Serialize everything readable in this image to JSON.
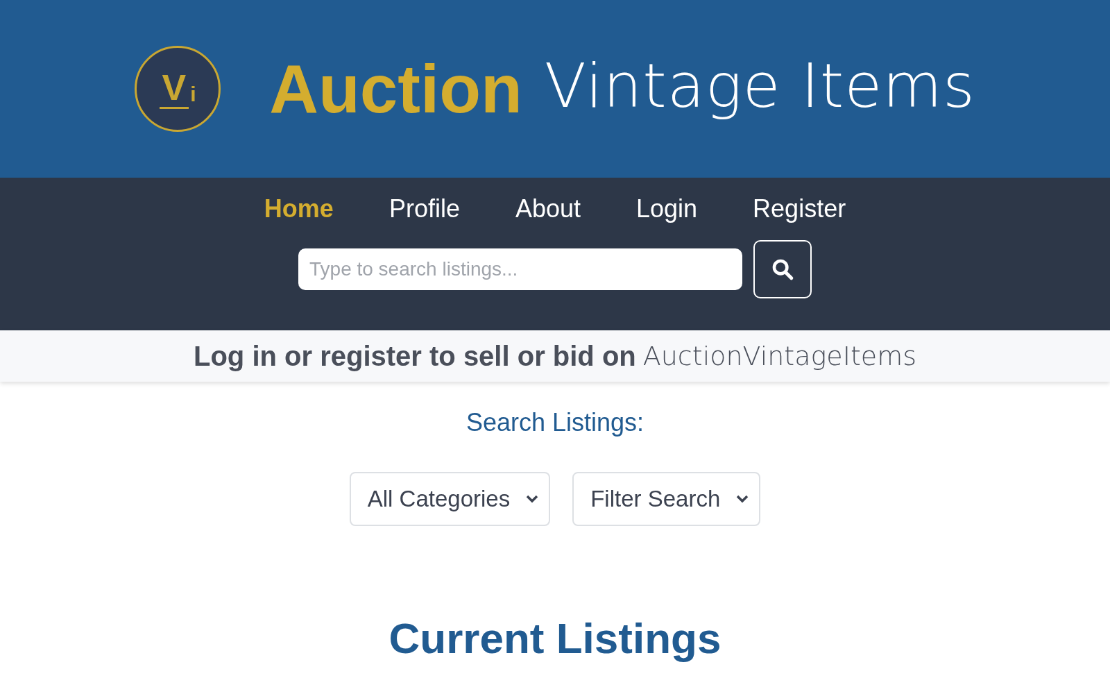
{
  "header": {
    "logo": {
      "letter": "V",
      "sub": "i"
    },
    "title_strong": "Auction",
    "title_light": "Vintage Items"
  },
  "nav": {
    "items": [
      {
        "label": "Home",
        "selected": true
      },
      {
        "label": "Profile",
        "selected": false
      },
      {
        "label": "About",
        "selected": false
      },
      {
        "label": "Login",
        "selected": false
      },
      {
        "label": "Register",
        "selected": false
      }
    ],
    "search": {
      "placeholder": "Type to search listings..."
    }
  },
  "banner": {
    "text": "Log in or register to sell or bid on",
    "brand": "AuctionVintageItems"
  },
  "search_section": {
    "heading": "Search Listings:",
    "selects": [
      {
        "value": "All Categories"
      },
      {
        "value": "Filter Search"
      }
    ]
  },
  "listings_heading": "Current Listings"
}
